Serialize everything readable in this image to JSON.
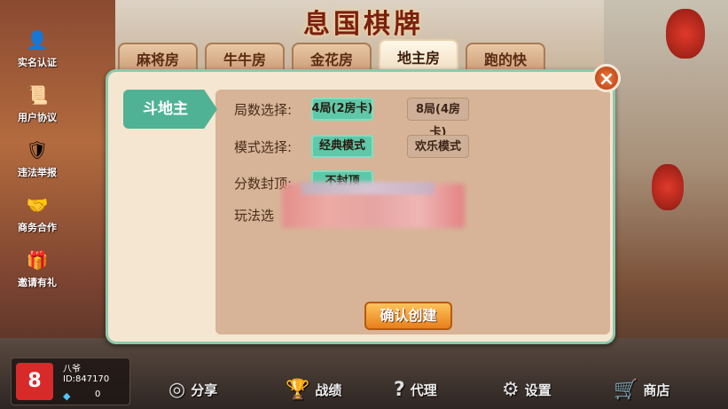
{
  "app": {
    "title": "息国棋牌"
  },
  "sidebar": {
    "items": [
      {
        "label": "实名认证",
        "icon": "id-card-icon",
        "glyph": "👤"
      },
      {
        "label": "用户协议",
        "icon": "agreement-icon",
        "glyph": "📜"
      },
      {
        "label": "违法举报",
        "icon": "report-shield-icon",
        "glyph": "🛡"
      },
      {
        "label": "商务合作",
        "icon": "handshake-icon",
        "glyph": "🤝"
      },
      {
        "label": "邀请有礼",
        "icon": "gift-icon",
        "glyph": "🎁"
      }
    ]
  },
  "tabs": [
    {
      "label": "麻将房",
      "active": false
    },
    {
      "label": "牛牛房",
      "active": false
    },
    {
      "label": "金花房",
      "active": false
    },
    {
      "label": "地主房",
      "active": true
    },
    {
      "label": "跑的快",
      "active": false
    }
  ],
  "panel": {
    "mode_tag": "斗地主",
    "rounds": {
      "label": "局数选择:",
      "options": [
        "4局(2房卡)",
        "8局(4房卡)"
      ],
      "selected": 0
    },
    "mode": {
      "label": "模式选择:",
      "options": [
        "经典模式",
        "欢乐模式"
      ],
      "selected": 0
    },
    "cap": {
      "label": "分数封顶:",
      "options": [
        "不封顶"
      ],
      "selected": 0
    },
    "play": {
      "label": "玩法选"
    },
    "confirm_label": "确认创建",
    "close_label": "×"
  },
  "user": {
    "name": "八爷",
    "id_text": "ID:847170",
    "diamonds": "0",
    "avatar_glyph": "8"
  },
  "bottom_nav": [
    {
      "label": "分享",
      "icon": "share-icon",
      "glyph": "◎"
    },
    {
      "label": "战绩",
      "icon": "trophy-icon",
      "glyph": "🏆"
    },
    {
      "label": "代理",
      "icon": "question-icon",
      "glyph": "?"
    },
    {
      "label": "设置",
      "icon": "gear-icon",
      "glyph": "⚙"
    },
    {
      "label": "商店",
      "icon": "cart-icon",
      "glyph": "🛒"
    }
  ],
  "colors": {
    "accent": "#4fb294",
    "selected": "#5ec8a8",
    "confirm": "#e7801c",
    "close": "#b33a12"
  }
}
